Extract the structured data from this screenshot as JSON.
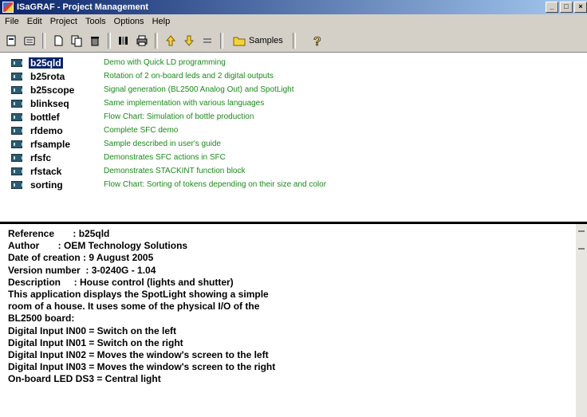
{
  "window": {
    "title": "ISaGRAF - Project Management"
  },
  "menu": [
    "File",
    "Edit",
    "Project",
    "Tools",
    "Options",
    "Help"
  ],
  "toolbar": {
    "samples_label": "Samples"
  },
  "projects": [
    {
      "name": "b25qld",
      "desc": "Demo with Quick LD programming",
      "selected": true
    },
    {
      "name": "b25rota",
      "desc": "Rotation of 2 on-board leds and 2 digital outputs"
    },
    {
      "name": "b25scope",
      "desc": "Signal generation (BL2500 Analog Out) and SpotLight"
    },
    {
      "name": "blinkseq",
      "desc": "Same implementation with various languages"
    },
    {
      "name": "bottlef",
      "desc": "Flow Chart: Simulation of bottle production"
    },
    {
      "name": "rfdemo",
      "desc": "Complete SFC demo"
    },
    {
      "name": "rfsample",
      "desc": "Sample described in user's guide"
    },
    {
      "name": "rfsfc",
      "desc": "Demonstrates SFC actions in SFC"
    },
    {
      "name": "rfstack",
      "desc": "Demonstrates STACKINT function block"
    },
    {
      "name": "sorting",
      "desc": "Flow Chart: Sorting of tokens depending on their size and color"
    }
  ],
  "details": [
    "Reference       : b25qld",
    "Author       : OEM Technology Solutions",
    "Date of creation : 9 August 2005",
    "Version number  : 3-0240G - 1.04",
    "Description     : House control (lights and shutter)",
    "",
    "This application displays the SpotLight showing a simple",
    "room of a house. It uses some of the physical I/O of the",
    "BL2500 board:",
    "Digital Input IN00 = Switch on the left",
    "Digital Input IN01 = Switch on the right",
    "Digital Input IN02 = Moves the window's screen to the left",
    "Digital Input IN03 = Moves the window's screen to the right",
    "On-board LED DS3 = Central light"
  ]
}
